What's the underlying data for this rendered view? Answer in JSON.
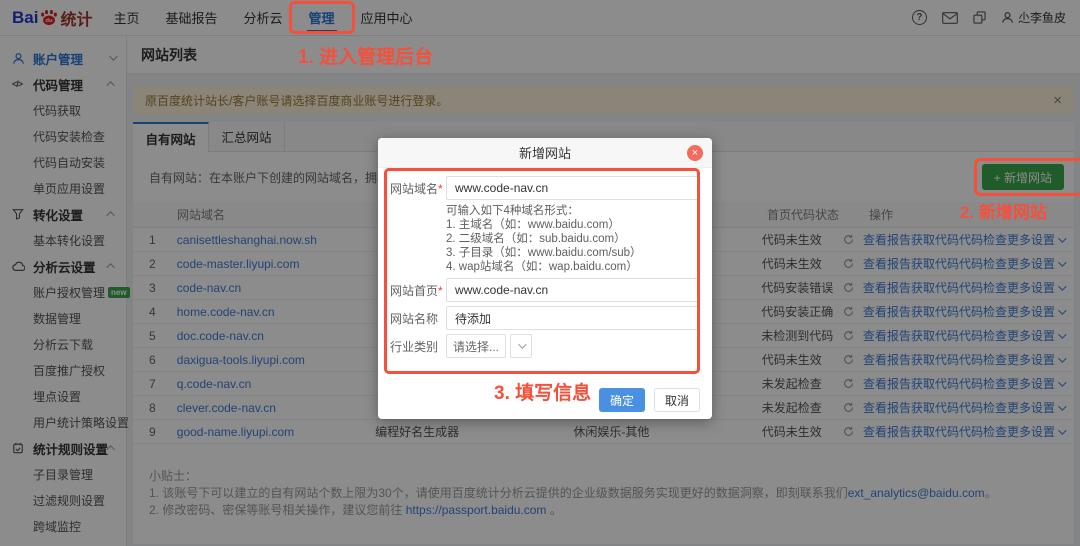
{
  "topbar": {
    "logo": {
      "part1": "Bai",
      "part2": "du",
      "part3": "统计"
    },
    "nav": [
      {
        "label": "主页",
        "active": false
      },
      {
        "label": "基础报告",
        "active": false
      },
      {
        "label": "分析云",
        "active": false
      },
      {
        "label": "管理",
        "active": true
      },
      {
        "label": "应用中心",
        "active": false
      }
    ],
    "user_name": "尐李鱼皮"
  },
  "sidebar": {
    "groups": [
      {
        "label": "账户管理",
        "icon": "user-icon",
        "chevron": "down",
        "active": true,
        "children": []
      },
      {
        "label": "代码管理",
        "icon": "code-icon",
        "chevron": "up",
        "active": false,
        "children": [
          {
            "label": "代码获取"
          },
          {
            "label": "代码安装检查"
          },
          {
            "label": "代码自动安装"
          },
          {
            "label": "单页应用设置"
          }
        ]
      },
      {
        "label": "转化设置",
        "icon": "funnel-icon",
        "chevron": "up",
        "active": false,
        "children": [
          {
            "label": "基本转化设置"
          }
        ]
      },
      {
        "label": "分析云设置",
        "icon": "cloud-icon",
        "chevron": "up",
        "active": false,
        "children": [
          {
            "label": "账户授权管理",
            "badge": "new"
          },
          {
            "label": "数据管理"
          },
          {
            "label": "分析云下载"
          },
          {
            "label": "百度推广授权"
          },
          {
            "label": "埋点设置"
          },
          {
            "label": "用户统计策略设置"
          }
        ]
      },
      {
        "label": "统计规则设置",
        "icon": "clipboard-icon",
        "chevron": "up",
        "active": false,
        "children": [
          {
            "label": "子目录管理"
          },
          {
            "label": "过滤规则设置"
          },
          {
            "label": "跨域监控"
          }
        ]
      }
    ]
  },
  "page": {
    "title": "网站列表",
    "notice": {
      "text": "原百度统计站长/客户账号请选择百度商业账号进行登录。",
      "close": "×"
    },
    "tabs": [
      {
        "label": "自有网站",
        "active": true
      },
      {
        "label": "汇总网站",
        "active": false
      }
    ],
    "intro": "自有网站：在本账户下创建的网站域名，拥有全部的查看和设置权限",
    "add_button": "+ 新增网站",
    "table": {
      "headers": [
        "网站域名",
        "",
        "",
        "首页代码状态",
        "操作"
      ],
      "action_labels": [
        "查看报告",
        "获取代码",
        "代码检查",
        "更多设置"
      ],
      "rows": [
        {
          "num": "1",
          "domain": "canisettleshanghai.now.sh",
          "name": "",
          "industry": "",
          "status": "代码未生效"
        },
        {
          "num": "2",
          "domain": "code-master.liyupi.com",
          "name": "",
          "industry": "",
          "status": "代码未生效"
        },
        {
          "num": "3",
          "domain": "code-nav.cn",
          "name": "",
          "industry": "",
          "status": "代码安装错误"
        },
        {
          "num": "4",
          "domain": "home.code-nav.cn",
          "name": "",
          "industry": "",
          "status": "代码安装正确"
        },
        {
          "num": "5",
          "domain": "doc.code-nav.cn",
          "name": "",
          "industry": "",
          "status": "未检测到代码"
        },
        {
          "num": "6",
          "domain": "daxigua-tools.liyupi.com",
          "name": "",
          "industry": "",
          "status": "代码未生效"
        },
        {
          "num": "7",
          "domain": "q.code-nav.cn",
          "name": "",
          "industry": "",
          "status": "未发起检查"
        },
        {
          "num": "8",
          "domain": "clever.code-nav.cn",
          "name": "",
          "industry": "",
          "status": "未发起检查"
        },
        {
          "num": "9",
          "domain": "good-name.liyupi.com",
          "name": "编程好名生成器",
          "industry": "休闲娱乐-其他",
          "status": "代码未生效"
        }
      ]
    },
    "tips": {
      "title": "小贴士：",
      "line1_pre": "1. 该账号下可以建立的自有网站个数上限为30个，请使用百度统计分析云提供的企业级数据服务实现更好的数据洞察，即刻联系我们",
      "line1_link": "ext_analytics@baidu.com",
      "line1_post": "。",
      "line2_pre": "2. 修改密码、密保等账号相关操作，建议您前往 ",
      "line2_link": "https://passport.baidu.com",
      "line2_post": " 。"
    }
  },
  "modal": {
    "title": "新增网站",
    "fields": [
      {
        "label": "网站域名",
        "required": true,
        "type": "input",
        "value": "www.code-nav.cn"
      },
      {
        "label": "网站首页",
        "required": true,
        "type": "input",
        "value": "www.code-nav.cn"
      },
      {
        "label": "网站名称",
        "required": false,
        "type": "input",
        "value": "待添加"
      },
      {
        "label": "行业类别",
        "required": false,
        "type": "select",
        "value": "请选择..."
      }
    ],
    "help_lines": [
      "可输入如下4种域名形式：",
      "1. 主域名（如：www.baidu.com）",
      "2. 二级域名（如：sub.baidu.com）",
      "3. 子目录（如：www.baidu.com/sub）",
      "4. wap站域名（如：wap.baidu.com）"
    ],
    "confirm": "确定",
    "cancel": "取消"
  },
  "annotations": {
    "step1": "1. 进入管理后台",
    "step2": "2. 新增网站",
    "step3": "3. 填写信息",
    "color": "#f4503c"
  },
  "colors": {
    "primary_blue": "#2d77d3",
    "link_blue": "#3b7dd8",
    "green": "#3aa84c",
    "confirm_blue": "#4a90e2",
    "notice_bg": "#fdf3dc",
    "annotation_red": "#f4503c",
    "modal_close_red": "#f56c5c"
  }
}
